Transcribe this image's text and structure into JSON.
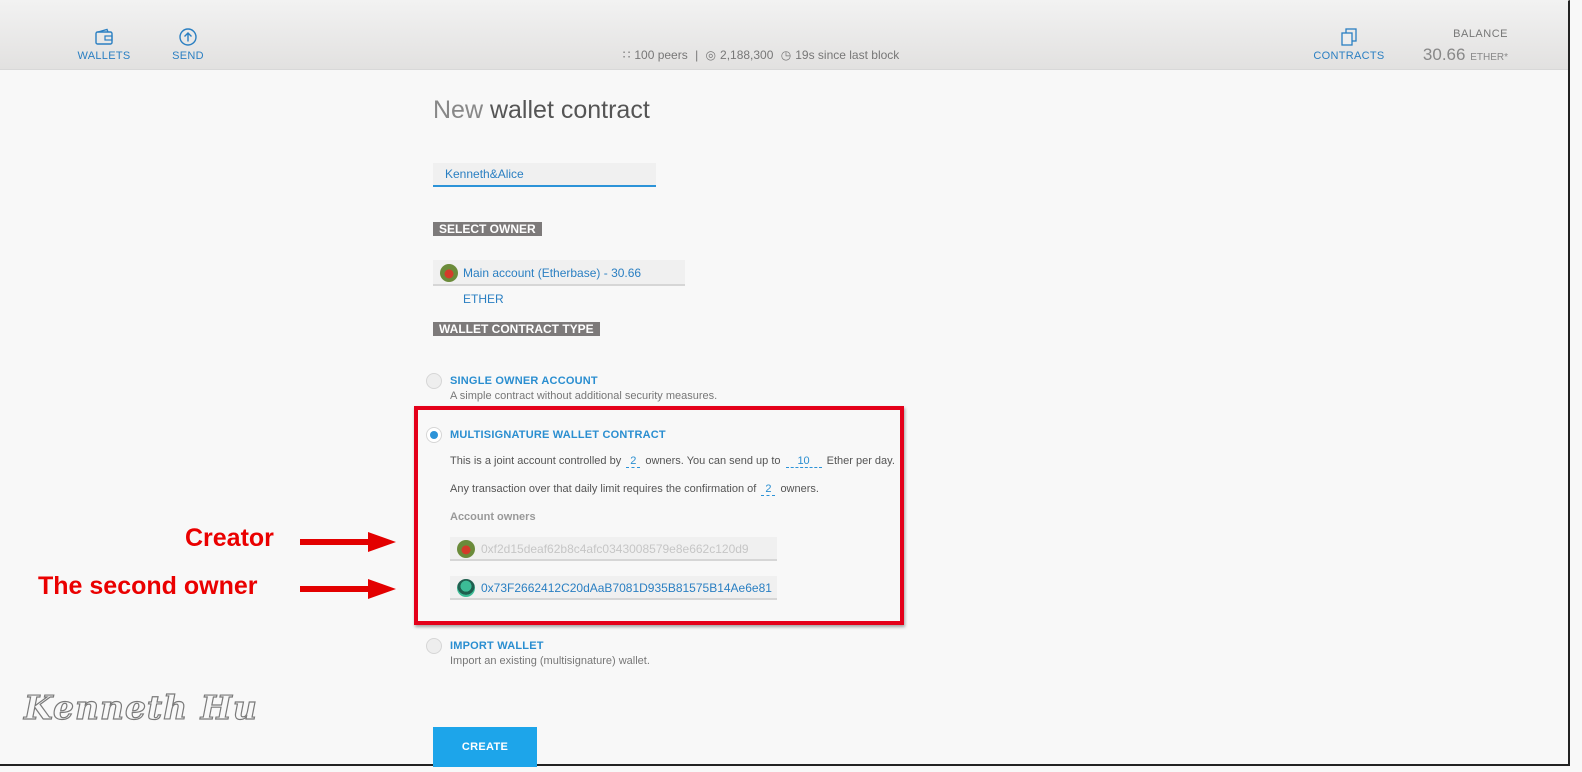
{
  "header": {
    "nav": [
      {
        "label": "WALLETS",
        "icon": "wallet-icon"
      },
      {
        "label": "SEND",
        "icon": "send-icon"
      },
      {
        "label": "CONTRACTS",
        "icon": "contracts-icon"
      }
    ],
    "status": {
      "peers": "100 peers",
      "separator": "|",
      "block": "2,188,300",
      "since": "19s since last block"
    },
    "balance": {
      "label": "BALANCE",
      "value": "30.66",
      "unit": "ETHER*"
    }
  },
  "main": {
    "title_prefix": "New",
    "title_bold": "wallet contract",
    "name_value": "Kenneth&Alice",
    "select_owner_label": "SELECT OWNER",
    "owner_selected": "Main account (Etherbase) - 30.66 ETHER",
    "type_label": "WALLET CONTRACT TYPE",
    "options": [
      {
        "title": "SINGLE OWNER ACCOUNT",
        "desc": "A simple contract without additional security measures.",
        "selected": false
      },
      {
        "title": "MULTISIGNATURE WALLET CONTRACT",
        "selected": true
      },
      {
        "title": "IMPORT WALLET",
        "desc": "Import an existing (multisignature) wallet.",
        "selected": false
      }
    ],
    "multisig": {
      "line1_a": "This is a joint account controlled by",
      "owners_count": "2",
      "line1_b": "owners. You can send up to",
      "daily_limit": "10",
      "line1_c": "Ether per day.",
      "line2_a": "Any transaction over that daily limit requires the confirmation of",
      "confirmations": "2",
      "line2_b": "owners.",
      "account_owners_label": "Account owners",
      "owner1": "0xf2d15deaf62b8c4afc0343008579e8e662c120d9",
      "owner2": "0x73F2662412C20dAaB7081D935B81575B14Ae6e81"
    },
    "create_label": "CREATE"
  },
  "annotations": {
    "creator": "Creator",
    "second_owner": "The second owner",
    "signature": "Kenneth Hu"
  },
  "colors": {
    "accent": "#2a8ed0",
    "button": "#1da5ea",
    "highlight_box": "#e4001a",
    "tag_bg": "#7d7a7a"
  }
}
